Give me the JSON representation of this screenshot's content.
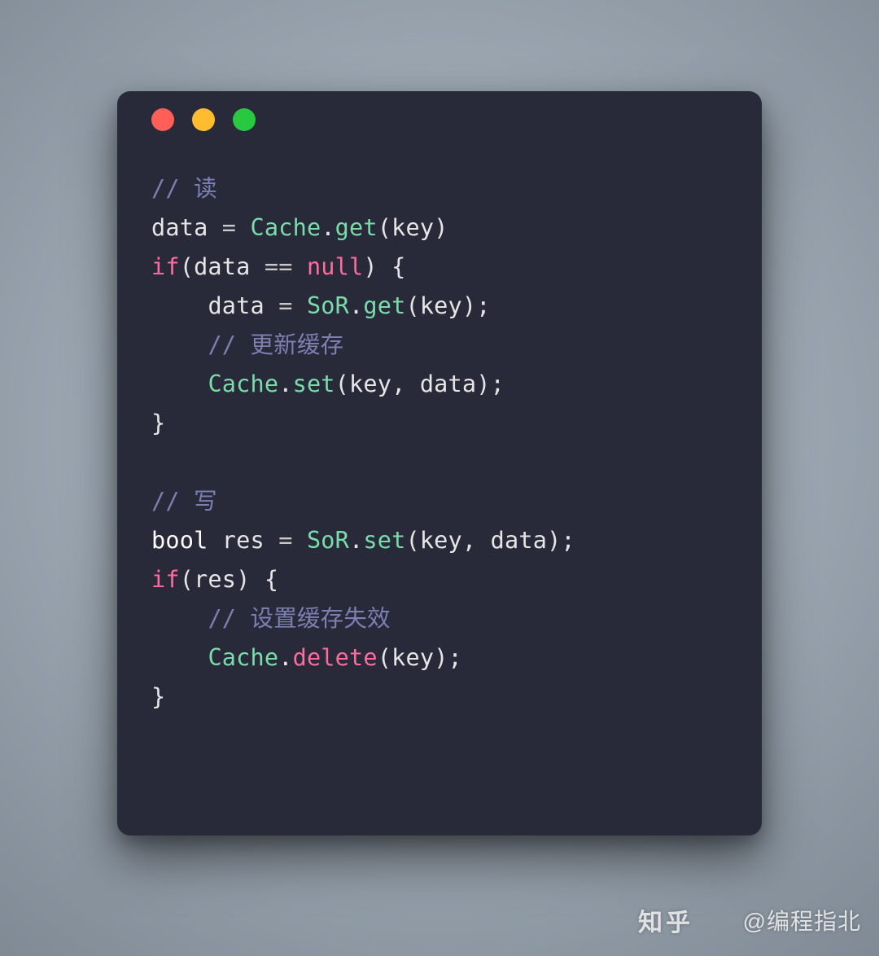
{
  "window": {
    "traffic_lights": [
      "red",
      "yellow",
      "green"
    ]
  },
  "code": {
    "indent": "    ",
    "lines": [
      {
        "tokens": [
          {
            "cls": "tok-comment",
            "text": "// 读"
          }
        ]
      },
      {
        "tokens": [
          {
            "cls": "tok-ident",
            "text": "data "
          },
          {
            "cls": "tok-op",
            "text": "= "
          },
          {
            "cls": "tok-class",
            "text": "Cache"
          },
          {
            "cls": "tok-punct",
            "text": "."
          },
          {
            "cls": "tok-method-g",
            "text": "get"
          },
          {
            "cls": "tok-punct",
            "text": "("
          },
          {
            "cls": "tok-ident",
            "text": "key"
          },
          {
            "cls": "tok-punct",
            "text": ")"
          }
        ]
      },
      {
        "tokens": [
          {
            "cls": "tok-keyword",
            "text": "if"
          },
          {
            "cls": "tok-punct",
            "text": "("
          },
          {
            "cls": "tok-ident",
            "text": "data "
          },
          {
            "cls": "tok-op",
            "text": "== "
          },
          {
            "cls": "tok-null",
            "text": "null"
          },
          {
            "cls": "tok-punct",
            "text": ") "
          },
          {
            "cls": "tok-brace",
            "text": "{"
          }
        ]
      },
      {
        "indent": 1,
        "tokens": [
          {
            "cls": "tok-ident",
            "text": "data "
          },
          {
            "cls": "tok-op",
            "text": "= "
          },
          {
            "cls": "tok-class",
            "text": "SoR"
          },
          {
            "cls": "tok-punct",
            "text": "."
          },
          {
            "cls": "tok-method-g",
            "text": "get"
          },
          {
            "cls": "tok-punct",
            "text": "("
          },
          {
            "cls": "tok-ident",
            "text": "key"
          },
          {
            "cls": "tok-punct",
            "text": ");"
          }
        ]
      },
      {
        "indent": 1,
        "tokens": [
          {
            "cls": "tok-comment",
            "text": "// 更新缓存"
          }
        ]
      },
      {
        "indent": 1,
        "tokens": [
          {
            "cls": "tok-class",
            "text": "Cache"
          },
          {
            "cls": "tok-punct",
            "text": "."
          },
          {
            "cls": "tok-method-g",
            "text": "set"
          },
          {
            "cls": "tok-punct",
            "text": "("
          },
          {
            "cls": "tok-ident",
            "text": "key"
          },
          {
            "cls": "tok-punct",
            "text": ", "
          },
          {
            "cls": "tok-ident",
            "text": "data"
          },
          {
            "cls": "tok-punct",
            "text": ");"
          }
        ]
      },
      {
        "tokens": [
          {
            "cls": "tok-brace",
            "text": "}"
          }
        ]
      },
      {
        "tokens": []
      },
      {
        "tokens": [
          {
            "cls": "tok-comment",
            "text": "// 写"
          }
        ]
      },
      {
        "tokens": [
          {
            "cls": "tok-type",
            "text": "bool "
          },
          {
            "cls": "tok-ident",
            "text": "res "
          },
          {
            "cls": "tok-op",
            "text": "= "
          },
          {
            "cls": "tok-class",
            "text": "SoR"
          },
          {
            "cls": "tok-punct",
            "text": "."
          },
          {
            "cls": "tok-method-g",
            "text": "set"
          },
          {
            "cls": "tok-punct",
            "text": "("
          },
          {
            "cls": "tok-ident",
            "text": "key"
          },
          {
            "cls": "tok-punct",
            "text": ", "
          },
          {
            "cls": "tok-ident",
            "text": "data"
          },
          {
            "cls": "tok-punct",
            "text": ");"
          }
        ]
      },
      {
        "tokens": [
          {
            "cls": "tok-keyword",
            "text": "if"
          },
          {
            "cls": "tok-punct",
            "text": "("
          },
          {
            "cls": "tok-ident",
            "text": "res"
          },
          {
            "cls": "tok-punct",
            "text": ") "
          },
          {
            "cls": "tok-brace",
            "text": "{"
          }
        ]
      },
      {
        "indent": 1,
        "tokens": [
          {
            "cls": "tok-comment",
            "text": "// 设置缓存失效"
          }
        ]
      },
      {
        "indent": 1,
        "tokens": [
          {
            "cls": "tok-class",
            "text": "Cache"
          },
          {
            "cls": "tok-punct",
            "text": "."
          },
          {
            "cls": "tok-method-r",
            "text": "delete"
          },
          {
            "cls": "tok-punct",
            "text": "("
          },
          {
            "cls": "tok-ident",
            "text": "key"
          },
          {
            "cls": "tok-punct",
            "text": ");"
          }
        ]
      },
      {
        "tokens": [
          {
            "cls": "tok-brace",
            "text": "}"
          }
        ]
      }
    ]
  },
  "watermark": {
    "logo": "知乎",
    "text": "@编程指北"
  }
}
